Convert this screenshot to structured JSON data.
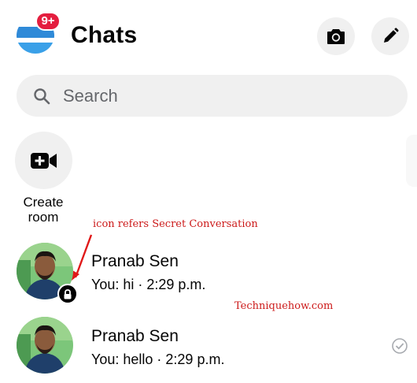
{
  "header": {
    "title": "Chats",
    "notification_badge": "9+",
    "camera_icon": "camera-icon",
    "compose_icon": "pencil-icon"
  },
  "search": {
    "placeholder": "Search"
  },
  "create_room": {
    "label_line1": "Create",
    "label_line2": "room",
    "icon": "video-camera-plus-icon"
  },
  "annotation": {
    "text": "icon refers Secret Conversation"
  },
  "watermark": "Techniquehow.com",
  "chats": [
    {
      "name": "Pranab Sen",
      "snippet": "You: hi · 2:29 p.m.",
      "secret": true
    },
    {
      "name": "Pranab Sen",
      "snippet": "You: hello · 2:29 p.m.",
      "secret": false,
      "status_icon": "delivered-check-icon"
    }
  ],
  "colors": {
    "badge": "#e41e3f",
    "surface": "#f0f0f0",
    "annotation": "#cc1a1a"
  }
}
